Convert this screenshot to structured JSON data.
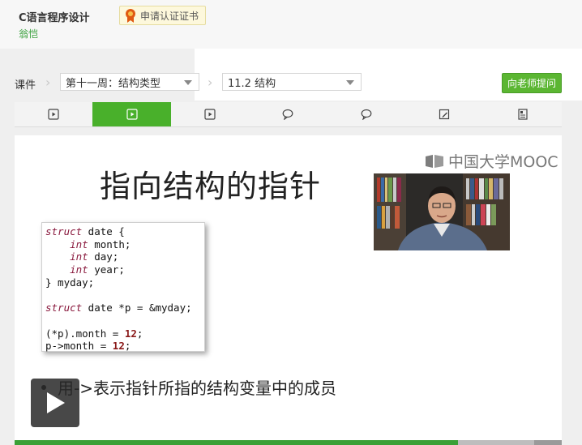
{
  "header": {
    "course_title": "C语言程序设计",
    "teacher": "翁恺",
    "certificate_label": "申请认证证书"
  },
  "breadcrumb": {
    "root": "课件",
    "week_select": "第十一周：结构类型",
    "lesson_select": "11.2 结构"
  },
  "ask_teacher_label": "向老师提问",
  "tabs": [
    {
      "icon": "video-icon",
      "active": false
    },
    {
      "icon": "video-icon",
      "active": true
    },
    {
      "icon": "video-icon",
      "active": false
    },
    {
      "icon": "discussion-icon",
      "active": false
    },
    {
      "icon": "discussion-icon",
      "active": false
    },
    {
      "icon": "quiz-icon",
      "active": false
    },
    {
      "icon": "document-icon",
      "active": false
    }
  ],
  "slide": {
    "logo_text": "中国大学MOOC",
    "title": "指向结构的指针",
    "code_lines": [
      "struct date {",
      "    int month;",
      "    int day;",
      "    int year;",
      "} myday;",
      "",
      "struct date *p = &myday;",
      "",
      "(*p).month = 12;",
      "p->month = 12;"
    ],
    "bullet": "用->表示指针所指的结构变量中的成员"
  },
  "player": {
    "progress": 0.81,
    "buffered": 0.95
  },
  "colors": {
    "accent_green": "#49b02b",
    "teacher_green": "#39a03c",
    "keyword": "#8a1a3e"
  }
}
